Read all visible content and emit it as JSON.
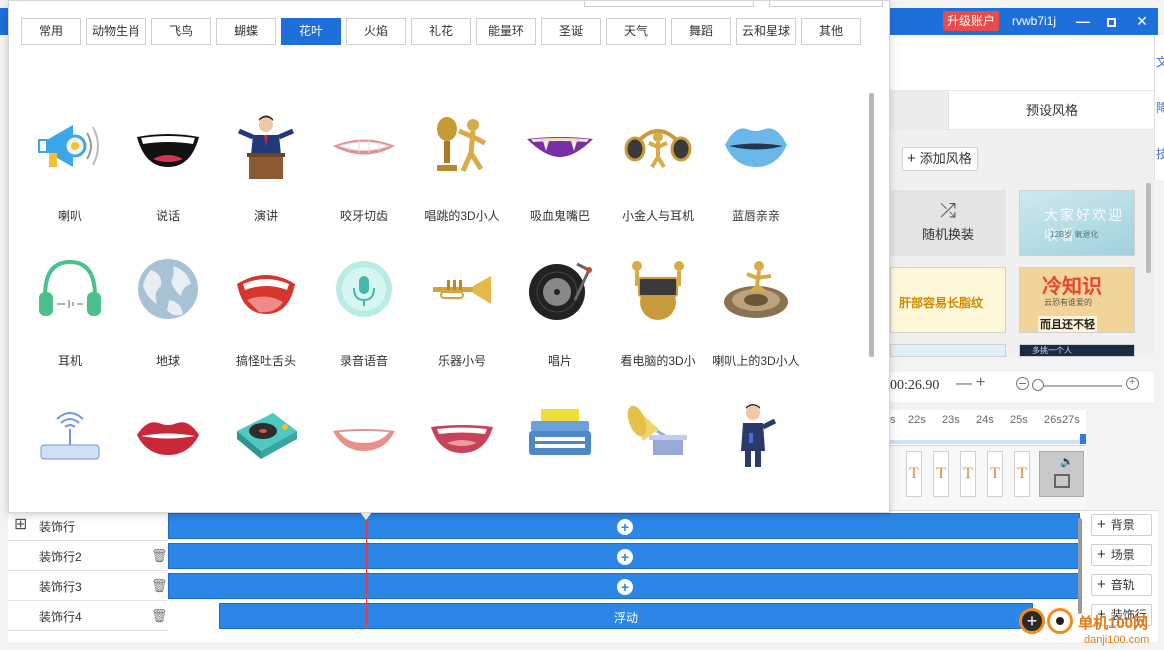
{
  "titlebar": {
    "upgrade_label": "升级账户",
    "username": "rvwb7i1j",
    "min_glyph": "—",
    "close_glyph": "✕"
  },
  "right_edge": {
    "chars": [
      "文",
      "降",
      "技"
    ]
  },
  "right_panel": {
    "tab_label": "预设风格",
    "add_style_label": "添加风格",
    "random_label": "随机换装",
    "thumb1_text": "大家好欢迎收看",
    "thumb1_sub": "12B岁 氧退化",
    "thumb2_text": "肝部容易长脂纹",
    "thumb3_title": "冷知识",
    "thumb3_sub": "云恐有谁爱的",
    "thumb3_bottom": "而且还不轻",
    "thumb5_text": "多挑一个人"
  },
  "timebar": {
    "time": "00:26.90",
    "minus": "—",
    "plus": "+"
  },
  "ruler": {
    "ticks": [
      "s",
      "22s",
      "23s",
      "24s",
      "25s",
      "26s",
      "27s"
    ]
  },
  "clips": {
    "text_glyph": "T",
    "audio_glyph": "🔈"
  },
  "tracks": [
    {
      "name": "装饰行",
      "side": "背景",
      "bar_text": ""
    },
    {
      "name": "装饰行2",
      "side": "场景",
      "bar_text": ""
    },
    {
      "name": "装饰行3",
      "side": "音轨",
      "bar_text": ""
    },
    {
      "name": "装饰行4",
      "side": "装饰行",
      "bar_text": "浮动"
    }
  ],
  "watermark": {
    "main": "单机100网",
    "sub": "danji100.com"
  },
  "categories": [
    {
      "label": "常用",
      "active": false
    },
    {
      "label": "动物生肖",
      "active": false
    },
    {
      "label": "飞鸟",
      "active": false
    },
    {
      "label": "蝴蝶",
      "active": false
    },
    {
      "label": "花叶",
      "active": true
    },
    {
      "label": "火焰",
      "active": false
    },
    {
      "label": "礼花",
      "active": false
    },
    {
      "label": "能量环",
      "active": false
    },
    {
      "label": "圣诞",
      "active": false
    },
    {
      "label": "天气",
      "active": false
    },
    {
      "label": "舞蹈",
      "active": false
    },
    {
      "label": "云和星球",
      "active": false
    },
    {
      "label": "其他",
      "active": false
    }
  ],
  "items": [
    {
      "label": "喇叭",
      "icon": "megaphone-icon"
    },
    {
      "label": "说话",
      "icon": "talking-mouth-icon"
    },
    {
      "label": "演讲",
      "icon": "speaker-podium-icon"
    },
    {
      "label": "咬牙切齿",
      "icon": "gritting-teeth-icon"
    },
    {
      "label": "唱跳的3D小人",
      "icon": "3d-singer-icon"
    },
    {
      "label": "吸血鬼嘴巴",
      "icon": "vampire-mouth-icon"
    },
    {
      "label": "小金人与耳机",
      "icon": "golden-man-headphones-icon"
    },
    {
      "label": "蓝唇亲亲",
      "icon": "blue-lips-icon"
    },
    {
      "label": "耳机",
      "icon": "headphones-icon"
    },
    {
      "label": "地球",
      "icon": "globe-icon"
    },
    {
      "label": "搞怪吐舌头",
      "icon": "tongue-out-icon"
    },
    {
      "label": "录音语音",
      "icon": "microphone-voice-icon"
    },
    {
      "label": "乐器小号",
      "icon": "trumpet-icon"
    },
    {
      "label": "唱片",
      "icon": "record-icon"
    },
    {
      "label": "看电脑的3D小",
      "icon": "3d-computer-icon"
    },
    {
      "label": "喇叭上的3D小人",
      "icon": "3d-speaker-man-icon"
    },
    {
      "label": "",
      "icon": "wifi-router-icon"
    },
    {
      "label": "",
      "icon": "red-lips-icon"
    },
    {
      "label": "",
      "icon": "turntable-icon"
    },
    {
      "label": "",
      "icon": "smile-mouth-icon"
    },
    {
      "label": "",
      "icon": "laughing-lips-icon"
    },
    {
      "label": "",
      "icon": "typewriter-icon"
    },
    {
      "label": "",
      "icon": "gramophone-icon"
    },
    {
      "label": "",
      "icon": "reporter-icon"
    }
  ]
}
